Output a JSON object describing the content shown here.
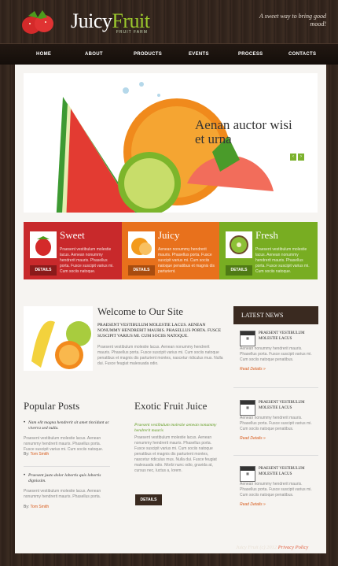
{
  "header": {
    "logo_part1": "Juicy",
    "logo_part2": "Fruit",
    "logo_sub": "FRUIT FARM",
    "tagline": "A sweet way to bring good mood!"
  },
  "nav": [
    "HOME",
    "ABOUT",
    "PRODUCTS",
    "EVENTS",
    "PROCESS",
    "CONTACTS"
  ],
  "slider": {
    "title_line1": "Aenan auctor wisi",
    "title_line2": "et urna",
    "prev_icon": "chevron-left-icon",
    "next_icon": "chevron-right-icon"
  },
  "boxes": [
    {
      "title": "Sweet",
      "text": "Praesent vestibulum molestie lacus. Aenean nonummy hendrerit mauris. Phasellus porta. Fusce suscipit varius mi. Cum sociis natoque.",
      "button": "DETAILS",
      "color": "#c8292b"
    },
    {
      "title": "Juicy",
      "text": "Aenean nonummy hendrerit mauris. Phasellus porta. Fusce suscipit varius mi. Cum sociis natoque penatibus et magnis dis parturient.",
      "button": "DETAILS",
      "color": "#e8711c"
    },
    {
      "title": "Fresh",
      "text": "Praesent vestibulum molestie lacus. Aenean nonummy hendrerit mauris. Phasellus porta. Fusce suscipit varius mi. Cum sociis natoque.",
      "button": "DETAILS",
      "color": "#78ad22"
    }
  ],
  "welcome": {
    "title": "Welcome to Our Site",
    "strong": "PRAESENT VESTIBULUM MOLESTIE LACUS. AENEAN NONUMMY HENDRERIT MAURIS. PHASELLUS PORTA. FUSCE SUSCIPIT VARIUS MI. CUM SOCIIS NATOQUE.",
    "body": "Praesent vestibulum molestie lacus. Aenean nonummy hendrerit mauris. Phasellus porta. Fusce suscipit varius mi. Cum sociis natoque penatibus et magnis dis parturient montes, nascetur ridiculus mus. Nulla dui. Fusce feugiat malesuada odio."
  },
  "news": {
    "header": "LATEST NEWS",
    "items": [
      {
        "cal": "cal",
        "title": "PRAESENT VESTIBULUM MOLESTIE LACUS",
        "body": "Aenean nonummy hendrerit mauris. Phasellus porta. Fusce suscipit varius mi. Cum sociis natoque penatibus.",
        "more": "Read Details »"
      },
      {
        "cal": "cal",
        "title": "PRAESENT VESTIBULUM MOLESTIE LACUS",
        "body": "Aenean nonummy hendrerit mauris. Phasellus porta. Fusce suscipit varius mi. Cum sociis natoque penatibus.",
        "more": "Read Details »"
      },
      {
        "cal": "cal",
        "title": "PRAESENT VESTIBULUM MOLESTIE LACUS",
        "body": "Aenean nonummy hendrerit mauris. Phasellus porta. Fusce suscipit varius mi. Cum sociis natoque penatibus.",
        "more": "Read Details »"
      }
    ]
  },
  "popular": {
    "title": "Popular Posts",
    "posts": [
      {
        "head": "Nam elit magna hendrerit sit amet tincidunt ac viverra sed nulla.",
        "body": "Praesent vestibulum molestie lacus. Aenean nonummy hendrerit mauris. Phasellus porta. Fusce suscipit varius mi. Cum sociis natoque.",
        "by": "By:",
        "author": "Tom Smith"
      },
      {
        "head": "Praesent justo dolor lobortis quis lobortis dignissim.",
        "body": "Praesent vestibulum molestie lacus. Aenean nonummy hendrerit mauris. Phasellus porta.",
        "by": "By:",
        "author": "Tom Smith"
      }
    ]
  },
  "exotic": {
    "title": "Exotic Fruit Juice",
    "sub": "Praesent vestibulum molestie aenean nonummy hendrerit mauris",
    "body": "Praesent vestibulum molestie lacus. Aenean nonummy hendrerit mauris. Phasellus porta. Fusce suscipit varius mi. Cum sociis natoque penatibus et magnis dis parturient montes, nascetur ridiculus mus. Nulla dui. Fusce feugiat malesuada odio. Morbi nunc odio, gravida at, cursus nec, luctus a, lorem.",
    "button": "DETAILS"
  },
  "footer": {
    "text": "Juicy Fruit (c) 2012",
    "link": "Privacy Policy"
  }
}
